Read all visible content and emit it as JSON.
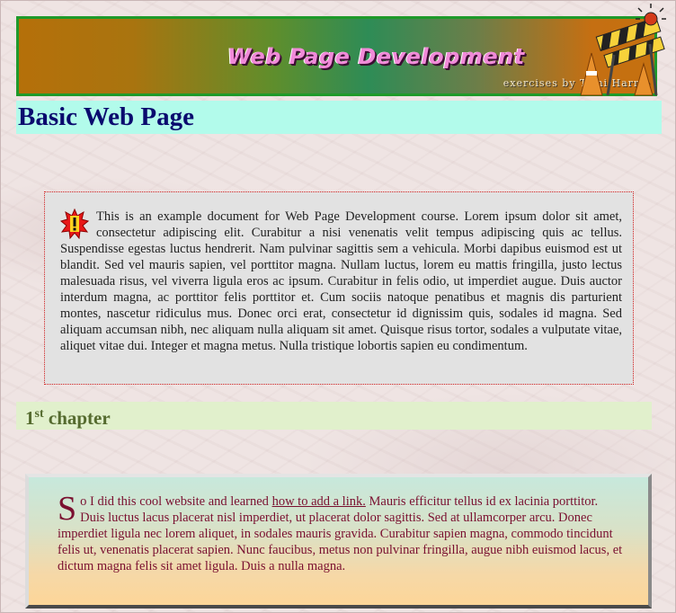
{
  "banner": {
    "title": "Web Page Development",
    "subtitle": "exercises by Tomi Harmo"
  },
  "page": {
    "title": "Basic Web Page"
  },
  "notice": {
    "icon": "warning-icon",
    "text": "This is an example document for Web Page Development course. Lorem ipsum dolor sit amet, consectetur adipiscing elit. Curabitur a nisi venenatis velit tempus adipiscing quis ac tellus. Suspendisse egestas luctus hendrerit. Nam pulvinar sagittis sem a vehicula. Morbi dapibus euismod est ut blandit. Sed vel mauris sapien, vel porttitor magna. Nullam luctus, lorem eu mattis fringilla, justo lectus malesuada risus, vel viverra ligula eros ac ipsum. Curabitur in felis odio, ut imperdiet augue. Duis auctor interdum magna, ac porttitor felis porttitor et. Cum sociis natoque penatibus et magnis dis parturient montes, nascetur ridiculus mus. Donec orci erat, consectetur id dignissim quis, sodales id magna. Sed aliquam accumsan nibh, nec aliquam nulla aliquam sit amet. Quisque risus tortor, sodales a vulputate vitae, aliquet vitae dui. Integer et magna metus. Nulla tristique lobortis sapien eu condimentum."
  },
  "chapter": {
    "number": "1",
    "suffix": "st",
    "title": " chapter"
  },
  "story": {
    "dropcap": "S",
    "lead": "o I did this cool website and learned ",
    "link": "how to add a link.",
    "rest": " Mauris efficitur tellus id ex lacinia porttitor. Duis luctus lacus placerat nisl imperdiet, ut placerat dolor sagittis. Sed at ullamcorper arcu. Donec imperdiet ligula nec lorem aliquet, in sodales mauris gravida. Curabitur sapien magna, commodo tincidunt felis ut, venenatis placerat sapien. Nunc faucibus, metus non pulvinar fringilla, augue nibh euismod lacus, et dictum magna felis sit amet ligula. Duis a nulla magna."
  },
  "colors": {
    "banner_border": "#1f9a2a",
    "title_bg": "#b2fbeb",
    "title_text": "#0a0a6e",
    "chapter_bg": "#e1f0cc",
    "chapter_text": "#556b2f",
    "notice_border": "#d42020",
    "story_text": "#7a1030"
  }
}
